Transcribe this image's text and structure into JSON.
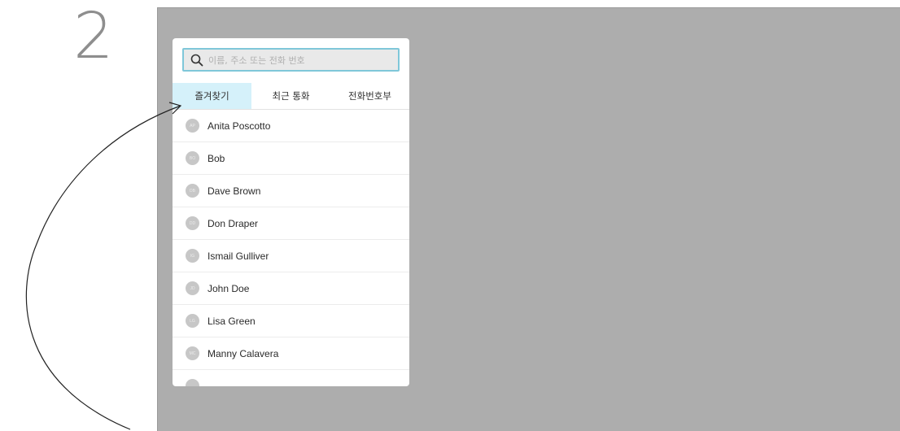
{
  "step_number": "2",
  "search": {
    "placeholder": "이름, 주소 또는 전화 번호"
  },
  "tabs": [
    {
      "label": "즐겨찾기",
      "active": true
    },
    {
      "label": "최근 통화",
      "active": false
    },
    {
      "label": "전화번호부",
      "active": false
    }
  ],
  "contacts": [
    {
      "initials": "AP",
      "name": "Anita Poscotto"
    },
    {
      "initials": "BO",
      "name": "Bob"
    },
    {
      "initials": "DB",
      "name": "Dave Brown"
    },
    {
      "initials": "DD",
      "name": "Don Draper"
    },
    {
      "initials": "IG",
      "name": "Ismail Gulliver"
    },
    {
      "initials": "JD",
      "name": "John Doe"
    },
    {
      "initials": "LG",
      "name": "Lisa Green"
    },
    {
      "initials": "MC",
      "name": "Manny Calavera"
    },
    {
      "initials": "",
      "name": ""
    }
  ],
  "colors": {
    "screen_bg": "#adadad",
    "active_tab_bg": "#d5f1fa",
    "search_border": "#7fc7d9"
  }
}
